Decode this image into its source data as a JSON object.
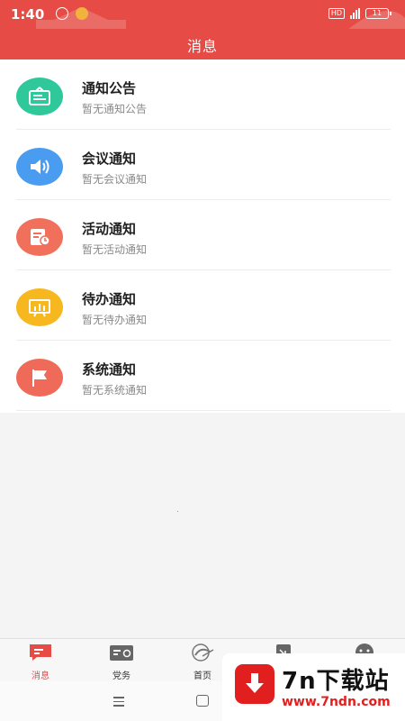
{
  "status_bar": {
    "time": "1:40",
    "network": "4G",
    "hd": "HD",
    "battery": "11"
  },
  "header": {
    "title": "消息"
  },
  "notifications": [
    {
      "title": "通知公告",
      "subtitle": "暂无通知公告",
      "icon": "notice-board-icon",
      "color": "#2ec89b"
    },
    {
      "title": "会议通知",
      "subtitle": "暂无会议通知",
      "icon": "speaker-icon",
      "color": "#4a9cf1"
    },
    {
      "title": "活动通知",
      "subtitle": "暂无活动通知",
      "icon": "calendar-clock-icon",
      "color": "#f0705c"
    },
    {
      "title": "待办通知",
      "subtitle": "暂无待办通知",
      "icon": "chart-board-icon",
      "color": "#f7b71f"
    },
    {
      "title": "系统通知",
      "subtitle": "暂无系统通知",
      "icon": "flag-icon",
      "color": "#ef6a58"
    }
  ],
  "tabs": [
    {
      "label": "消息",
      "icon": "message-icon",
      "active": true
    },
    {
      "label": "党务",
      "icon": "party-affairs-icon",
      "active": false
    },
    {
      "label": "首页",
      "icon": "home-logo-icon",
      "active": false
    },
    {
      "label": "",
      "icon": "document-icon",
      "active": false
    },
    {
      "label": "",
      "icon": "profile-icon",
      "active": false
    }
  ],
  "watermark": {
    "title": "7n下载站",
    "url": "www.7ndn.com"
  },
  "colors": {
    "accent": "#e64b45",
    "text_primary": "#1f1f1f",
    "text_secondary": "#8a8a8a"
  }
}
